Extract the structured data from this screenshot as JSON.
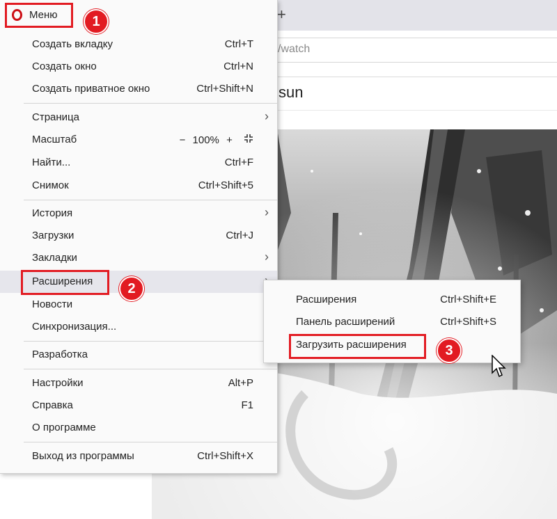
{
  "browser": {
    "new_tab_symbol": "+",
    "url_fragment": "/watch",
    "page_title_fragment": "sun"
  },
  "menu": {
    "title": "Меню",
    "badge_1": "1",
    "badge_2": "2",
    "badge_3": "3",
    "items": {
      "new_tab": {
        "label": "Создать вкладку",
        "shortcut": "Ctrl+T"
      },
      "new_window": {
        "label": "Создать окно",
        "shortcut": "Ctrl+N"
      },
      "private_window": {
        "label": "Создать приватное окно",
        "shortcut": "Ctrl+Shift+N"
      },
      "page": {
        "label": "Страница"
      },
      "zoom": {
        "label": "Масштаб",
        "minus": "−",
        "value": "100%",
        "plus": "+"
      },
      "find": {
        "label": "Найти...",
        "shortcut": "Ctrl+F"
      },
      "snapshot": {
        "label": "Снимок",
        "shortcut": "Ctrl+Shift+5"
      },
      "history": {
        "label": "История"
      },
      "downloads": {
        "label": "Загрузки",
        "shortcut": "Ctrl+J"
      },
      "bookmarks": {
        "label": "Закладки"
      },
      "extensions": {
        "label": "Расширения"
      },
      "news": {
        "label": "Новости"
      },
      "sync": {
        "label": "Синхронизация..."
      },
      "developer": {
        "label": "Разработка"
      },
      "settings": {
        "label": "Настройки",
        "shortcut": "Alt+P"
      },
      "help": {
        "label": "Справка",
        "shortcut": "F1"
      },
      "about": {
        "label": "О программе"
      },
      "exit": {
        "label": "Выход из программы",
        "shortcut": "Ctrl+Shift+X"
      }
    }
  },
  "submenu": {
    "items": {
      "extensions": {
        "label": "Расширения",
        "shortcut": "Ctrl+Shift+E"
      },
      "extensions_panel": {
        "label": "Панель расширений",
        "shortcut": "Ctrl+Shift+S"
      },
      "get_extensions": {
        "label": "Загрузить расширения"
      }
    }
  },
  "colors": {
    "highlight": "#e21b22",
    "menu_bg": "#fafafa",
    "active_row": "#e6e6ec"
  }
}
